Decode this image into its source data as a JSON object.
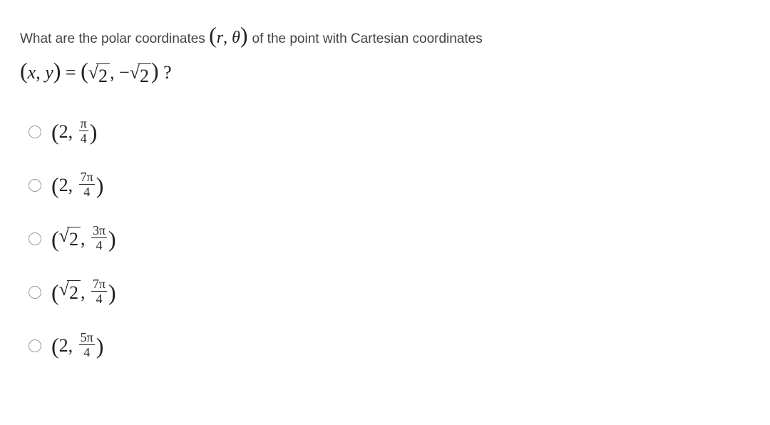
{
  "question": {
    "prefix": "What are the polar coordinates ",
    "polar_expr": "(r, θ)",
    "middle": " of the point with Cartesian coordinates",
    "cartesian_lhs": "(x, y) = ",
    "sqrt_arg": "2",
    "qmark": " ?"
  },
  "options": [
    {
      "r_type": "int",
      "r": "2",
      "theta_num": "π",
      "theta_den": "4"
    },
    {
      "r_type": "int",
      "r": "2",
      "theta_num": "7π",
      "theta_den": "4"
    },
    {
      "r_type": "sqrt",
      "r_sqrt_arg": "2",
      "theta_num": "3π",
      "theta_den": "4"
    },
    {
      "r_type": "sqrt",
      "r_sqrt_arg": "2",
      "theta_num": "7π",
      "theta_den": "4"
    },
    {
      "r_type": "int",
      "r": "2",
      "theta_num": "5π",
      "theta_den": "4"
    }
  ]
}
